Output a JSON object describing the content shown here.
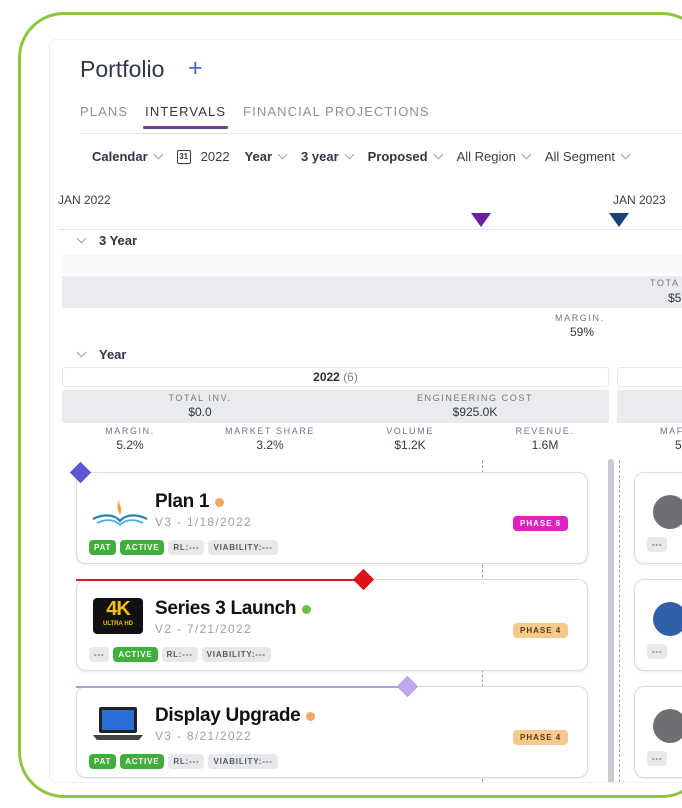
{
  "header": {
    "title": "Portfolio",
    "add_icon": "plus-icon"
  },
  "tabs": [
    {
      "label": "PLANS",
      "active": false
    },
    {
      "label": "INTERVALS",
      "active": true
    },
    {
      "label": "FINANCIAL PROJECTIONS",
      "active": false
    }
  ],
  "filters": {
    "calendar": "Calendar",
    "year_value": "2022",
    "year": "Year",
    "span": "3 year",
    "status": "Proposed",
    "region": "All Region",
    "segment": "All Segment"
  },
  "timeline": {
    "start_label": "JAN 2022",
    "next_label": "JAN 2023",
    "markers": [
      {
        "name": "purple-marker",
        "color": "#6b1fa0"
      },
      {
        "name": "navy-marker",
        "color": "#1f3f7a"
      }
    ]
  },
  "three_year": {
    "label": "3 Year",
    "total_label": "TOTA",
    "total_value": "$5",
    "margin_label": "MARGIN.",
    "margin_value": "59%"
  },
  "year_section": {
    "label": "Year",
    "year_title": "2022",
    "year_count": "(6)",
    "total_inv_label": "TOTAL INV.",
    "total_inv_value": "$0.0",
    "eng_cost_label": "ENGINEERING COST",
    "eng_cost_value": "$925.0K",
    "metrics": [
      {
        "label": "MARGIN.",
        "value": "5.2%"
      },
      {
        "label": "MARKET SHARE",
        "value": "3.2%"
      },
      {
        "label": "VOLUME",
        "value": "$1.2K"
      },
      {
        "label": "REVENUE.",
        "value": "1.6M"
      }
    ],
    "next_col_label": "MAF",
    "next_col_value": "5"
  },
  "plans": [
    {
      "name": "Plan 1",
      "version": "V3 - 1/18/2022",
      "status_dot": "#f0a860",
      "chips": [
        "PAT",
        "ACTIVE",
        "RL:---",
        "VIABILITY:---"
      ],
      "phase": "PHASE 6",
      "phase_bg": "#e020c0",
      "phase_fg": "#ffffff",
      "icon": "book-lamp-logo-icon"
    },
    {
      "name": "Series 3 Launch",
      "version": "V2 - 7/21/2022",
      "status_dot": "#6cbf4a",
      "chips": [
        "---",
        "ACTIVE",
        "RL:---",
        "VIABILITY:---"
      ],
      "phase": "PHASE 4",
      "phase_bg": "#f7c98d",
      "phase_fg": "#5b3a12",
      "icon": "4k-ultra-hd-icon",
      "icon_text_big": "4K",
      "icon_text_small": "ULTRA HD"
    },
    {
      "name": "Display Upgrade",
      "version": "V3 - 8/21/2022",
      "status_dot": "#f0a860",
      "chips": [
        "PAT",
        "ACTIVE",
        "RL:---",
        "VIABILITY:---"
      ],
      "phase": "PHASE 4",
      "phase_bg": "#f7c98d",
      "phase_fg": "#5b3a12",
      "icon": "laptop-icon"
    }
  ]
}
